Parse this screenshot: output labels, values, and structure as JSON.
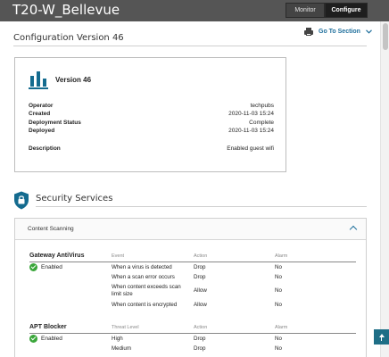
{
  "app": {
    "title": "T20-W_Bellevue",
    "tabs": [
      {
        "label": "Monitor",
        "active": false
      },
      {
        "label": "Configure",
        "active": true
      }
    ]
  },
  "page": {
    "title": "Configuration Version 46",
    "goto_label": "Go To Section",
    "print_icon": "printer-icon"
  },
  "version_card": {
    "icon": "bar-chart-icon",
    "version_label": "Version 46",
    "fields": [
      {
        "label": "Operator",
        "value": "techpubs"
      },
      {
        "label": "Created",
        "value": "2020-11-03 15:24"
      },
      {
        "label": "Deployment Status",
        "value": "Complete"
      },
      {
        "label": "Deployed",
        "value": "2020-11-03 15:24"
      }
    ],
    "description": {
      "label": "Description",
      "value": "Enabled guest wifi"
    }
  },
  "security": {
    "title": "Security Services",
    "icon": "lock-icon",
    "panel_title": "Content Scanning",
    "gateway": {
      "name": "Gateway AntiVirus",
      "status": "Enabled",
      "columns": [
        "Event",
        "Action",
        "Alarm"
      ],
      "rows": [
        {
          "event": "When a virus is detected",
          "action": "Drop",
          "alarm": "No"
        },
        {
          "event": "When a scan error occurs",
          "action": "Drop",
          "alarm": "No"
        },
        {
          "event": "When content exceeds scan limit size",
          "action": "Allow",
          "alarm": "No"
        },
        {
          "event": "When content is encrypted",
          "action": "Allow",
          "alarm": "No"
        }
      ]
    },
    "apt": {
      "name": "APT Blocker",
      "status": "Enabled",
      "columns": [
        "Threat Level",
        "Action",
        "Alarm"
      ],
      "rows": [
        {
          "event": "High",
          "action": "Drop",
          "alarm": "No"
        },
        {
          "event": "Medium",
          "action": "Drop",
          "alarm": "No"
        }
      ]
    }
  },
  "colors": {
    "accent": "#1f6f9c",
    "topbar": "#555555",
    "success": "#3aa63a"
  }
}
